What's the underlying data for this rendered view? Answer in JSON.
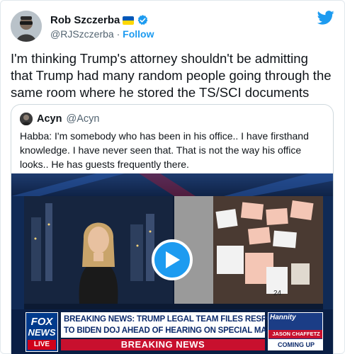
{
  "author": {
    "name": "Rob Szczerba",
    "handle": "@RJSzczerba",
    "separator": "·",
    "follow_label": "Follow"
  },
  "icons": {
    "flag": "ukraine-flag-icon",
    "verified": "verified-badge-icon",
    "brand": "twitter-bird-icon",
    "play": "play-icon"
  },
  "tweet": {
    "text": "I'm thinking Trump's attorney shouldn't be admitting that Trump had many random people going through the same room where he stored the TS/SCI documents"
  },
  "quote": {
    "name": "Acyn",
    "handle": "@Acyn",
    "text": "Habba: I'm somebody who has been in his office.. I have firsthand knowledge. I have never seen that. That is not the way his office looks.. He has guests frequently there."
  },
  "video": {
    "network_top": "FOX",
    "network_bottom": "NEWS",
    "live_label": "LIVE",
    "headline_line1": "BREAKING NEWS: TRUMP LEGAL TEAM FILES RESPONSE",
    "headline_line2": "TO BIDEN DOJ AHEAD OF HEARING ON SPECIAL MASTER",
    "breaking_label": "BREAKING NEWS",
    "promo_show": "Hannity",
    "promo_guest": "JASON CHAFFETZ",
    "promo_coming": "COMING UP",
    "card_number": "24"
  },
  "colors": {
    "accent": "#1d9bf0",
    "text": "#0f1419",
    "muted": "#536471",
    "fox_red": "#c8102e",
    "fox_blue": "#0c2a6b"
  }
}
